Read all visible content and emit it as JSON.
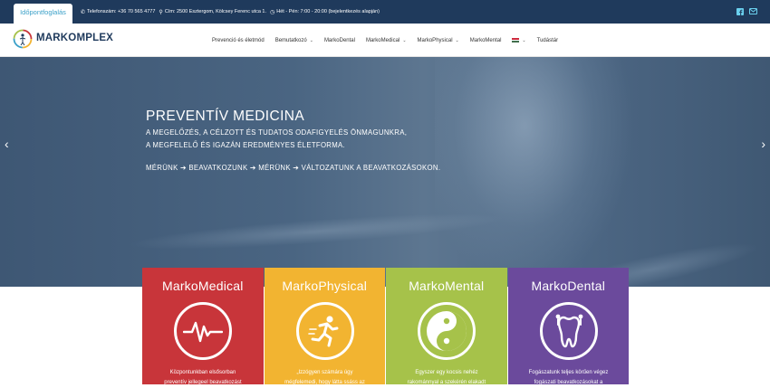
{
  "topbar": {
    "appointment_tab": "Időpontfoglalás",
    "phone": "Telefonszám: +36 70 565 4777",
    "address": "Cím: 2500 Esztergom, Kölcsey Ferenc utca 1.",
    "hours": "Hét - Pén: 7:00 - 20:00 (bejelentkezés alapján)",
    "icons": [
      "phone-icon",
      "location-pin-icon",
      "clock-icon",
      "facebook-icon",
      "email-icon"
    ],
    "background": "#1f3a5c"
  },
  "header": {
    "logo_text": "MARKOMPLEX",
    "nav": [
      {
        "label": "Prevenció és életmód",
        "dropdown": false
      },
      {
        "label": "Bemutatkozó",
        "dropdown": true
      },
      {
        "label": "MarkoDental",
        "dropdown": false
      },
      {
        "label": "MarkoMedical",
        "dropdown": true
      },
      {
        "label": "MarkoPhysical",
        "dropdown": true
      },
      {
        "label": "MarkoMental",
        "dropdown": false
      },
      {
        "label": "Tudástár",
        "dropdown": false
      }
    ],
    "language_flag": "hungarian-flag-icon"
  },
  "hero": {
    "title": "PREVENTÍV MEDICINA",
    "line1": "A MEGELŐZÉS, A CÉLZOTT ÉS TUDATOS ODAFIGYELÉS ÖNMAGUNKRA,",
    "line2": "A MEGFELELŐ ÉS IGAZÁN EREDMÉNYES ÉLETFORMA.",
    "line3": "MÉRÜNK ➔ BEAVATKOZUNK ➔ MÉRÜNK ➔ VÁLTOZATUNK A BEAVATKOZÁSOKON.",
    "prev_arrow": "‹",
    "next_arrow": "›"
  },
  "cards": [
    {
      "title": "MarkoMedical",
      "icon": "heartbeat-icon",
      "color": "#c8353a",
      "desc1": "Központunkban elsősorban",
      "desc2": "preventív jellegeel beavatkozást"
    },
    {
      "title": "MarkoPhysical",
      "icon": "running-figure-icon",
      "color": "#f2b431",
      "desc1": "„Izzógyen számára úgy",
      "desc2": "mégfelemedi, hogy látta ssáss az"
    },
    {
      "title": "MarkoMental",
      "icon": "yin-yang-icon",
      "color": "#a6c24a",
      "desc1": "Egyszer egy kocsis nehéz",
      "desc2": "rakománnyal a szekérén elakadt"
    },
    {
      "title": "MarkoDental",
      "icon": "tooth-icon",
      "color": "#6b4a9c",
      "desc1": "Fogászatunk teljes körűen végez",
      "desc2": "fogászati beavatkozásokat a"
    }
  ]
}
